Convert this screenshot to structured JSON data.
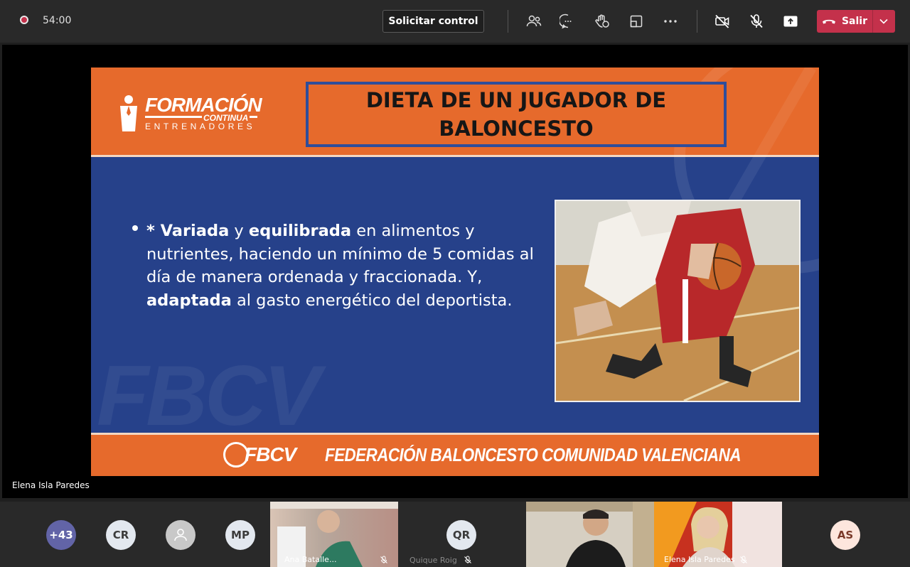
{
  "meeting": {
    "timer": "54:00",
    "request_control_label": "Solicitar control",
    "leave_label": "Salir"
  },
  "toolbar_icons": [
    "people-icon",
    "chat-icon",
    "raise-hand-icon",
    "rooms-icon",
    "more-icon",
    "camera-off-icon",
    "mic-off-icon",
    "share-icon"
  ],
  "slide": {
    "logo_main": "FORMACIÓN",
    "logo_sub1": "CONTINUA",
    "logo_sub2": "ENTRENADORES",
    "title": "DIETA DE UN JUGADOR DE\nBALONCESTO",
    "bullet": {
      "p1": "* Variada",
      "p2": " y ",
      "p3": "equilibrada",
      "p4": " en alimentos y nutrientes, haciendo un mínimo de 5 comidas al día de manera ordenada y fraccionada.  Y, ",
      "p5": "adaptada",
      "p6": " al gasto energético del deportista."
    },
    "watermark": "FBCV",
    "footer_logo": "FBCV",
    "footer_text": "FEDERACIÓN BALONCESTO COMUNIDAD VALENCIANA"
  },
  "presenter_name": "Elena Isla Paredes",
  "participants": {
    "overflow": "+43",
    "avatars": [
      {
        "initials": "CR",
        "color": "#e3e8ef"
      },
      {
        "initials": "",
        "color": "#c8c8c8"
      },
      {
        "initials": "MP",
        "color": "#e3e8ef"
      },
      {
        "initials": "QR",
        "color": "#e3e8ef"
      },
      {
        "initials": "AS",
        "color": "#fde6dd"
      }
    ],
    "tile_names": [
      "Ana Batalle...",
      "Quique Roig",
      "Elena Isla Paredes"
    ]
  },
  "colors": {
    "accent_orange": "#e66a2c",
    "slide_blue": "#26418a",
    "leave_red": "#c4314b",
    "overflow_purple": "#6264a7"
  }
}
